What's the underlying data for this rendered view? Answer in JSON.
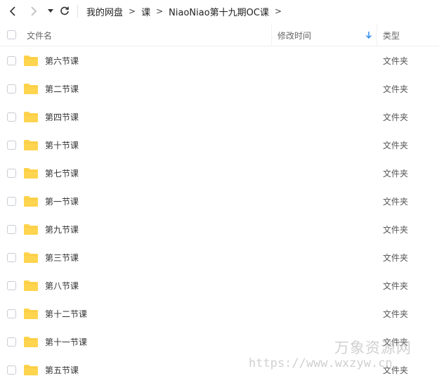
{
  "breadcrumb": [
    "我的网盘",
    "课",
    "NiaoNiao第十九期OC课"
  ],
  "breadcrumb_separator": ">",
  "columns": {
    "name": "文件名",
    "modified": "修改时间",
    "type": "类型"
  },
  "files": [
    {
      "name": "第六节课",
      "type": "文件夹"
    },
    {
      "name": "第二节课",
      "type": "文件夹"
    },
    {
      "name": "第四节课",
      "type": "文件夹"
    },
    {
      "name": "第十节课",
      "type": "文件夹"
    },
    {
      "name": "第七节课",
      "type": "文件夹"
    },
    {
      "name": "第一节课",
      "type": "文件夹"
    },
    {
      "name": "第九节课",
      "type": "文件夹"
    },
    {
      "name": "第三节课",
      "type": "文件夹"
    },
    {
      "name": "第八节课",
      "type": "文件夹"
    },
    {
      "name": "第十二节课",
      "type": "文件夹"
    },
    {
      "name": "第十一节课",
      "type": "文件夹"
    },
    {
      "name": "第五节课",
      "type": "文件夹"
    }
  ],
  "watermark": {
    "name": "万象资源网",
    "url": "https://www.wxzyw.cn"
  },
  "colors": {
    "folder": "#ffd44e",
    "sort_arrow": "#2d8cf0"
  }
}
